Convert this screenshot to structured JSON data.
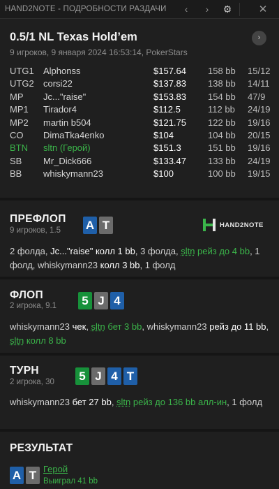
{
  "window": {
    "title": "HAND2NOTE - ПОДРОБНОСТИ РАЗДАЧИ",
    "prev_icon": "‹",
    "next_icon": "›",
    "settings_icon": "⚙",
    "close_icon": "✕"
  },
  "hand": {
    "title": "0.5/1 NL Texas Hold’em",
    "subtitle": "9 игроков, 9 января 2024 16:53:14, PokerStars",
    "nav_icon": "›"
  },
  "players": [
    {
      "pos": "UTG1",
      "name": "Alphonss",
      "stack": "$157.64",
      "bb": "158 bb",
      "cards": "15/12",
      "hero": false
    },
    {
      "pos": "UTG2",
      "name": "corsi22",
      "stack": "$137.83",
      "bb": "138 bb",
      "cards": "14/11",
      "hero": false
    },
    {
      "pos": "MP",
      "name": "Jc...\"raise\"",
      "stack": "$153.83",
      "bb": "154 bb",
      "cards": "47/9",
      "hero": false
    },
    {
      "pos": "MP1",
      "name": "Tirador4",
      "stack": "$112.5",
      "bb": "112 bb",
      "cards": "24/19",
      "hero": false
    },
    {
      "pos": "MP2",
      "name": "martin b504",
      "stack": "$121.75",
      "bb": "122 bb",
      "cards": "19/16",
      "hero": false
    },
    {
      "pos": "CO",
      "name": "DimaTka4enko",
      "stack": "$104",
      "bb": "104 bb",
      "cards": "20/15",
      "hero": false
    },
    {
      "pos": "BTN",
      "name": "sltn (Герой)",
      "stack": "$151.3",
      "bb": "151 bb",
      "cards": "19/16",
      "hero": true
    },
    {
      "pos": "SB",
      "name": "Mr_Dick666",
      "stack": "$133.47",
      "bb": "133 bb",
      "cards": "24/19",
      "hero": false
    },
    {
      "pos": "BB",
      "name": "whiskymann23",
      "stack": "$100",
      "bb": "100 bb",
      "cards": "19/15",
      "hero": false
    }
  ],
  "preflop": {
    "title": "ПРЕФЛОП",
    "sub": "9 игроков, 1.5",
    "cards": [
      {
        "rank": "A",
        "suit": "diamond"
      },
      {
        "rank": "T",
        "suit": "spade"
      }
    ],
    "logo_text": "HAND2NOTE",
    "a1": "2 фолда, ",
    "a2": "Jc...\"raise\"",
    "a3": " колл 1 bb",
    "a4": ", 3 фолда, ",
    "a5": "sltn",
    "a6": " рейз до 4 bb",
    "a7": ", 1 фолд, ",
    "a8": "whiskymann23",
    "a9": " колл 3 bb",
    "a10": ", 1 фолд"
  },
  "flop": {
    "title": "ФЛОП",
    "sub": "2 игрока, 9.1",
    "cards": [
      {
        "rank": "5",
        "suit": "club"
      },
      {
        "rank": "J",
        "suit": "spade"
      },
      {
        "rank": "4",
        "suit": "diamond"
      }
    ],
    "a1": "whiskymann23",
    "a2": " чек",
    "a3": ", ",
    "a4": "sltn",
    "a5": " бет 3 bb",
    "a6": ", ",
    "a7": "whiskymann23",
    "a8": " рейз до 11 bb",
    "a9": ", ",
    "a10": "sltn",
    "a11": " колл 8 bb"
  },
  "turn": {
    "title": "ТУРН",
    "sub": "2 игрока, 30",
    "cards": [
      {
        "rank": "5",
        "suit": "club"
      },
      {
        "rank": "J",
        "suit": "spade"
      },
      {
        "rank": "4",
        "suit": "diamond"
      },
      {
        "rank": "T",
        "suit": "diamond"
      }
    ],
    "a1": "whiskymann23",
    "a2": " бет 27 bb",
    "a3": ", ",
    "a4": "sltn",
    "a5": " рейз до 136 bb алл-ин",
    "a6": ", 1 фолд"
  },
  "result": {
    "title": "РЕЗУЛЬТАТ",
    "cards": [
      {
        "rank": "A",
        "suit": "diamond"
      },
      {
        "rank": "T",
        "suit": "spade"
      }
    ],
    "hero_label": "Герой",
    "win_text": "Выиграл 41 bb"
  }
}
